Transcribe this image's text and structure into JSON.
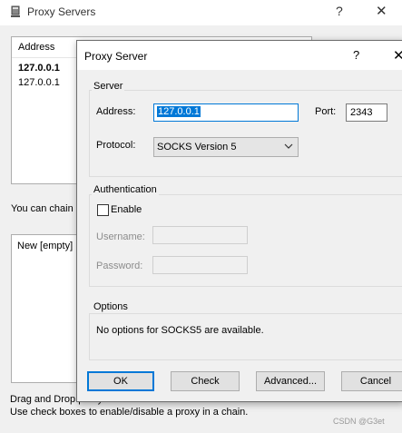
{
  "background_window": {
    "title": "Proxy Servers",
    "help": "?",
    "close": "✕",
    "list": {
      "column_address": "Address",
      "rows": [
        "127.0.0.1",
        "127.0.0.1"
      ]
    },
    "chain_text": "You can chain s",
    "chain_list_item": "New [empty]",
    "hint_line1": "Drag and Drop proxy servers within a chain to alter the order.",
    "hint_line2": "Use check boxes to enable/disable a proxy in a chain."
  },
  "dialog": {
    "title": "Proxy Server",
    "help": "?",
    "close": "✕",
    "server_group": {
      "label": "Server",
      "address_label": "Address:",
      "address_value": "127.0.0.1",
      "port_label": "Port:",
      "port_value": "2343",
      "protocol_label": "Protocol:",
      "protocol_value": "SOCKS Version 5"
    },
    "auth_group": {
      "label": "Authentication",
      "enable_label": "Enable",
      "enable_checked": false,
      "username_label": "Username:",
      "password_label": "Password:"
    },
    "options_group": {
      "label": "Options",
      "text": "No options for SOCKS5 are available."
    },
    "buttons": {
      "ok": "OK",
      "check": "Check",
      "advanced": "Advanced...",
      "cancel": "Cancel"
    }
  },
  "watermark": "CSDN @G3et",
  "colors": {
    "accent": "#0078d7",
    "window_bg": "#f0f0f0"
  }
}
